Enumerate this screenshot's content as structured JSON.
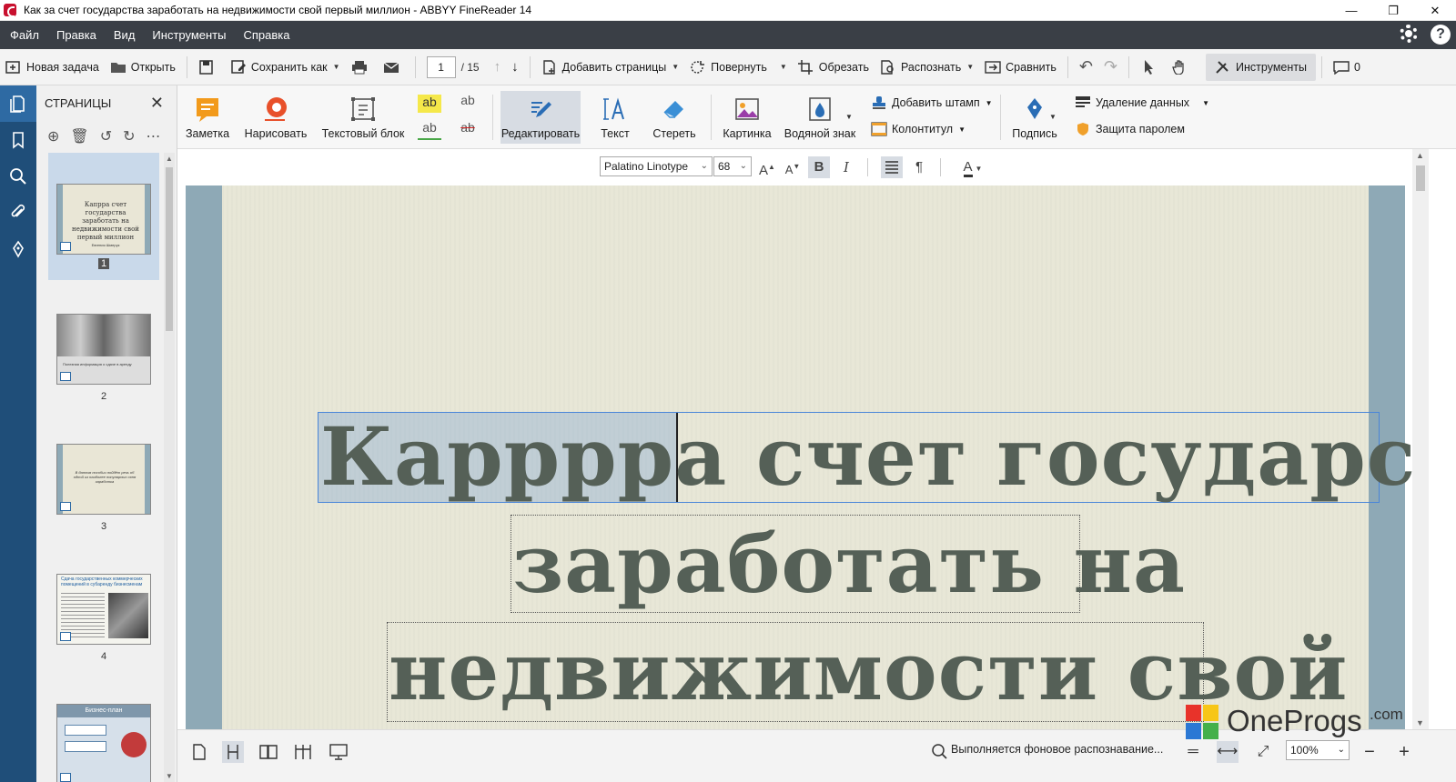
{
  "window": {
    "title": "Как за счет государства заработать на недвижимости свой первый миллион - ABBYY FineReader 14",
    "controls": [
      "—",
      "❐",
      "✕"
    ]
  },
  "menu": [
    "Файл",
    "Правка",
    "Вид",
    "Инструменты",
    "Справка"
  ],
  "toolbar": {
    "new_task": "Новая задача",
    "open": "Открыть",
    "save_as": "Сохранить как",
    "page_current": "1",
    "page_total": "/ 15",
    "add_pages": "Добавить страницы",
    "rotate": "Повернуть",
    "crop": "Обрезать",
    "recognize": "Распознать",
    "compare": "Сравнить",
    "tools": "Инструменты",
    "comments_count": "0"
  },
  "pages_panel": {
    "title": "СТРАНИЦЫ",
    "thumbnails": [
      {
        "number": "1",
        "text": "Капрра счет государства заработать на недвижимости свой первый миллион",
        "author": "Евгения Шмерук"
      },
      {
        "number": "2",
        "text": "Полезная информация о сдаче в аренду"
      },
      {
        "number": "3",
        "text": "В данном пособии пойдёт речь об одной из наиболее популярных схем заработка"
      },
      {
        "number": "4",
        "text": "Сдача государственных коммерческих помещений в субаренду бизнесменам"
      },
      {
        "number": "",
        "text": "Бизнес-план"
      }
    ]
  },
  "ribbon": {
    "note": "Заметка",
    "draw": "Нарисовать",
    "text_block": "Текстовый блок",
    "edit": "Редактировать",
    "text": "Текст",
    "erase": "Стереть",
    "picture": "Картинка",
    "watermark": "Водяной знак",
    "add_stamp": "Добавить штамп",
    "header_footer": "Колонтитул",
    "signature": "Подпись",
    "redact": "Удаление данных",
    "password": "Защита паролем",
    "ab": "ab"
  },
  "format": {
    "font": "Palatino Linotype",
    "size": "68",
    "bold": "B",
    "italic": "I"
  },
  "document": {
    "line1_selected": "Карррра",
    "line1_rest": " счет государства",
    "line2": "заработать на",
    "line3": "недвижимости свой"
  },
  "status": {
    "text": "Выполняется фоновое распознавание...",
    "zoom": "100%"
  },
  "overlay": {
    "logo_text": "OneProgs",
    "logo_suffix": ".com"
  }
}
